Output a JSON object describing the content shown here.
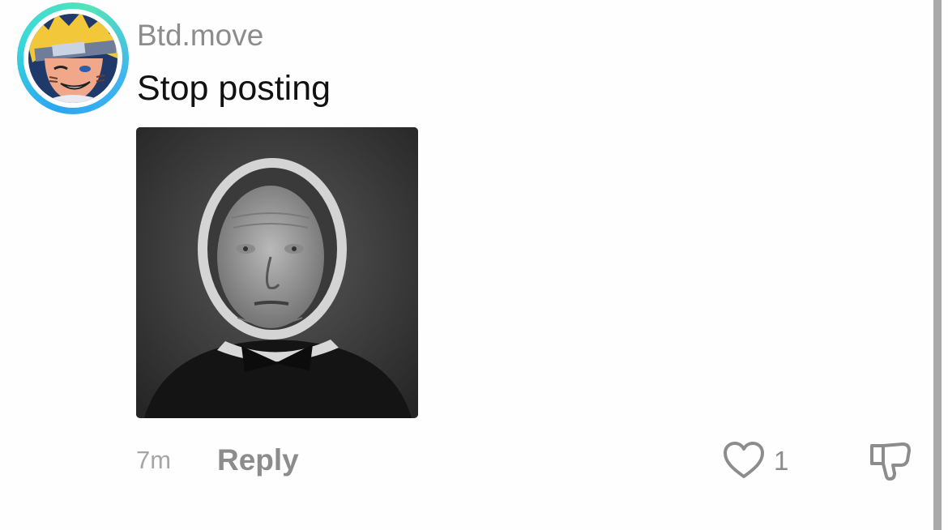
{
  "comment": {
    "username": "Btd.move",
    "text": "Stop posting",
    "timestamp": "7m",
    "reply_label": "Reply",
    "like_count": "1"
  },
  "icons": {
    "like": "heart-icon",
    "dislike": "thumbs-down-icon"
  },
  "colors": {
    "avatar_ring_start": "#2aa6f2",
    "avatar_ring_end": "#55e2b8",
    "secondary_text": "#8c8c8c",
    "primary_text": "#111111"
  }
}
